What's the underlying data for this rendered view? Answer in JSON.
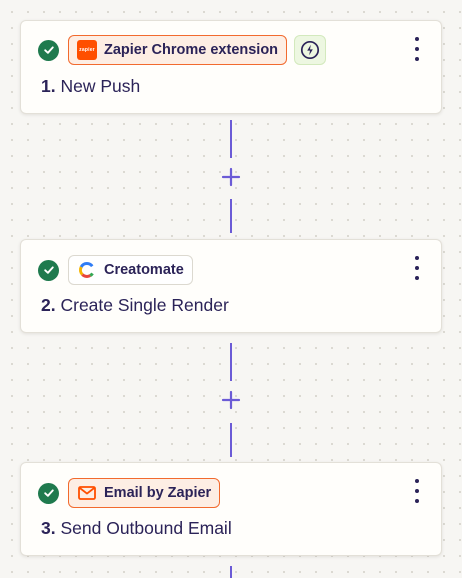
{
  "colors": {
    "accent_purple": "#6b5bd6",
    "check_green": "#1f7a4e",
    "zapier_orange": "#ff4f00",
    "text_dark": "#2b2358"
  },
  "steps": [
    {
      "number": "1.",
      "title": "New Push",
      "app_name": "Zapier Chrome extension",
      "app_icon": "zapier-logo-icon",
      "app_logo_text": "zapier",
      "status_icon": "check-circle-icon",
      "instant_badge_icon": "lightning-bolt-icon",
      "menu_icon": "kebab-menu-icon"
    },
    {
      "number": "2.",
      "title": "Create Single Render",
      "app_name": "Creatomate",
      "app_icon": "creatomate-logo-icon",
      "status_icon": "check-circle-icon",
      "menu_icon": "kebab-menu-icon"
    },
    {
      "number": "3.",
      "title": "Send Outbound Email",
      "app_name": "Email by Zapier",
      "app_icon": "email-envelope-icon",
      "status_icon": "check-circle-icon",
      "menu_icon": "kebab-menu-icon"
    }
  ],
  "connectors": [
    {
      "add_step_icon": "plus-icon"
    },
    {
      "add_step_icon": "plus-icon"
    }
  ]
}
